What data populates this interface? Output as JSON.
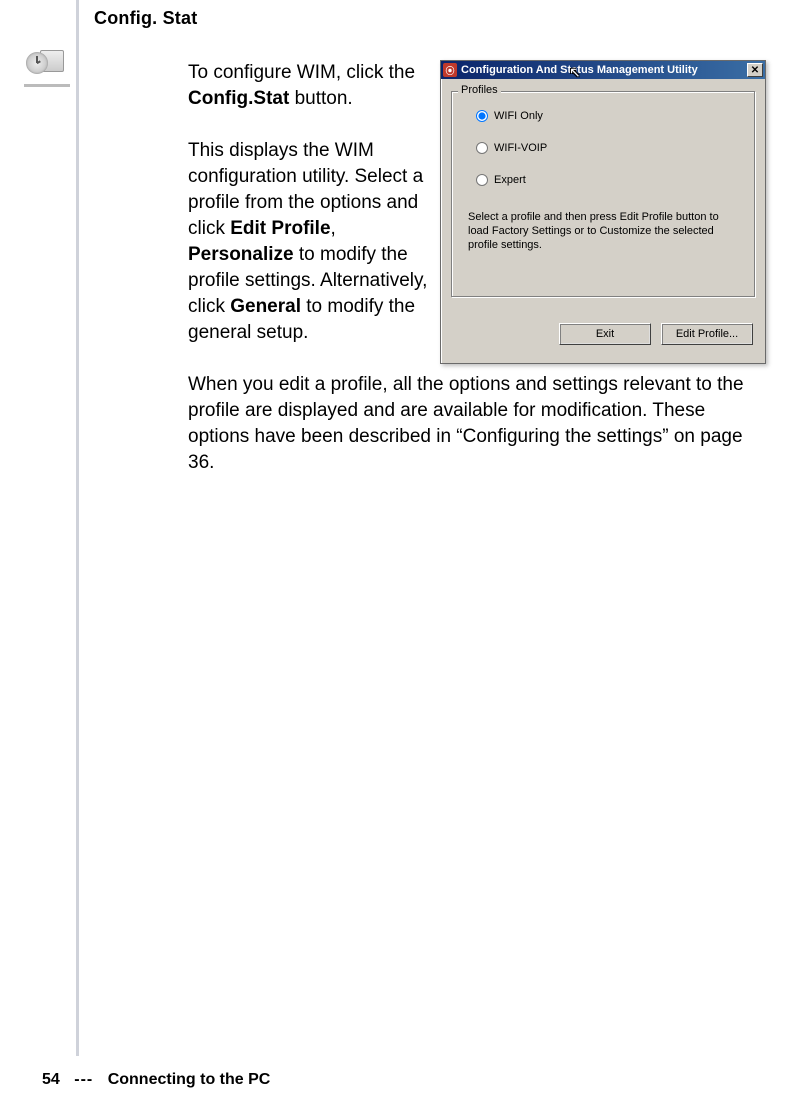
{
  "heading": "Config. Stat",
  "paragraphs": {
    "p1a": "To configure WIM, click the ",
    "p1b": "Config.Stat",
    "p1c": " button.",
    "p2a": "This displays the WIM configuration utility. Select a pro­file from the options and click ",
    "p2b": "Edit Profile",
    "p2c": ", ",
    "p2d": "Personalize",
    "p2e": " to mod­ify the profile set­tings. Alternatively, click ",
    "p2f": "General",
    "p2g": " to mod­ify the general setup.",
    "p3": "When you edit a profile, all the options and settings rele­vant to the profile are displayed and are available for modification. These options have been described in “Configuring the settings” on page 36."
  },
  "footer": {
    "page": "54",
    "sep": "---",
    "chapter": "Connecting to the PC"
  },
  "dialog": {
    "title": "Configuration And Status Management Utility",
    "group_label": "Profiles",
    "options": {
      "opt1": "WIFI Only",
      "opt2": "WIFI-VOIP",
      "opt3": "Expert"
    },
    "help": "Select a profile and then press Edit Profile button to load Factory Settings or to Customize the selected profile settings.",
    "buttons": {
      "exit": "Exit",
      "edit": "Edit Profile..."
    },
    "close": "✕"
  }
}
